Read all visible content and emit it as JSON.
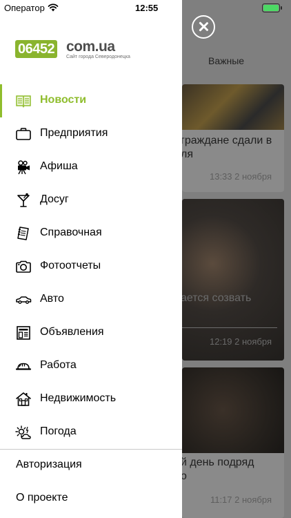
{
  "status_bar": {
    "carrier": "Оператор",
    "time": "12:55"
  },
  "background": {
    "tab_label": "Важные",
    "cards": [
      {
        "title": "граждане сдали в\nля",
        "time": "13:33 2 ноября"
      },
      {
        "title": "ается созвать",
        "time": "12:19 2 ноября"
      },
      {
        "title": "й день подряд\nо",
        "time": "11:17 2 ноября"
      }
    ]
  },
  "logo": {
    "number": "06452",
    "domain": "com.ua",
    "tagline": "Сайт города Северодонецка"
  },
  "menu": [
    {
      "label": "Новости",
      "icon": "newspaper-icon",
      "active": true
    },
    {
      "label": "Предприятия",
      "icon": "briefcase-icon"
    },
    {
      "label": "Афиша",
      "icon": "movie-camera-icon"
    },
    {
      "label": "Досуг",
      "icon": "cocktail-icon"
    },
    {
      "label": "Справочная",
      "icon": "notebook-icon"
    },
    {
      "label": "Фотоотчеты",
      "icon": "camera-icon"
    },
    {
      "label": "Авто",
      "icon": "car-icon"
    },
    {
      "label": "Объявления",
      "icon": "storefront-icon"
    },
    {
      "label": "Работа",
      "icon": "hard-hat-icon"
    },
    {
      "label": "Недвижимость",
      "icon": "house-icon"
    },
    {
      "label": "Погода",
      "icon": "weather-icon"
    }
  ],
  "footer": [
    {
      "label": "Авторизация"
    },
    {
      "label": "О проекте"
    }
  ],
  "colors": {
    "accent": "#8fbd2d",
    "overlay": "#7f7f7f"
  }
}
